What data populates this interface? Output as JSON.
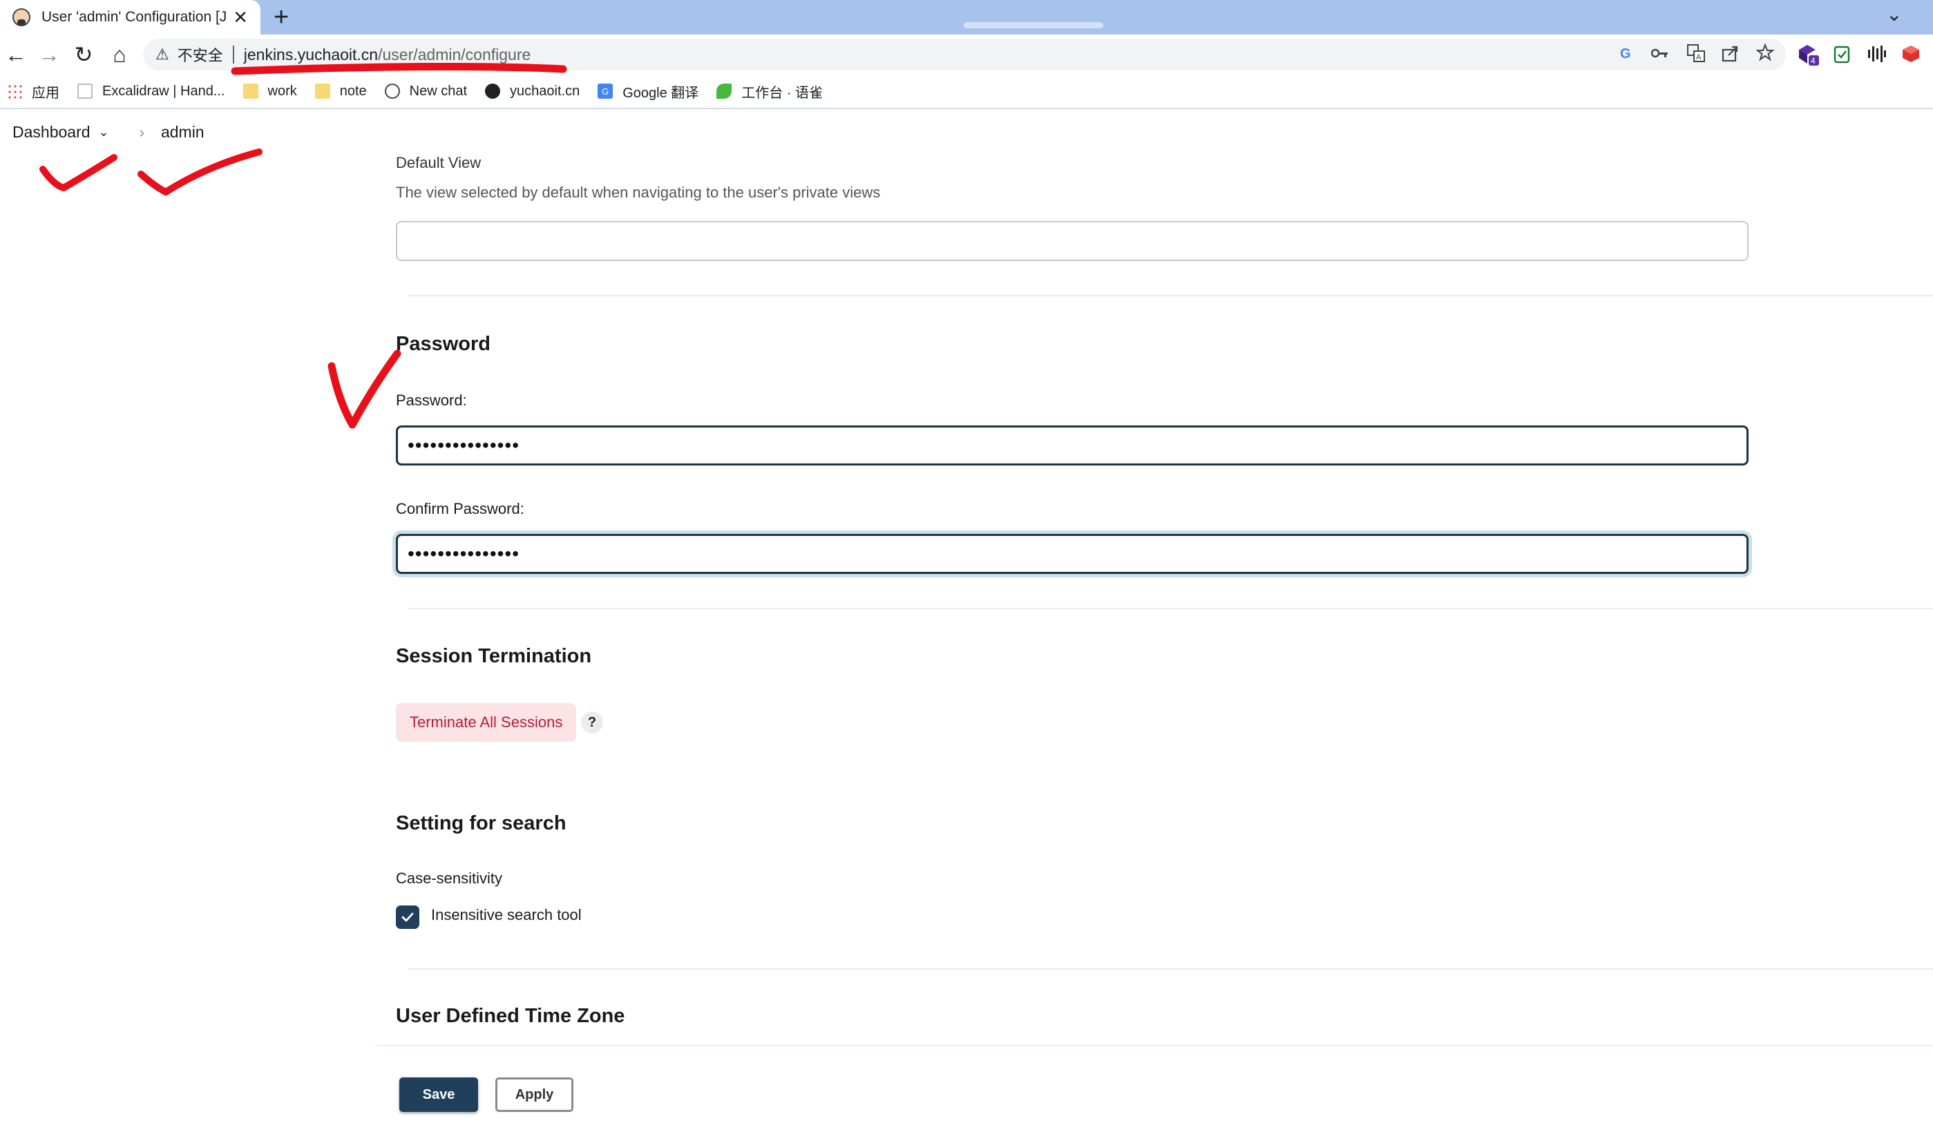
{
  "browser": {
    "tab": {
      "title": "User 'admin' Configuration [Je",
      "close": "✕"
    },
    "new_tab": "+",
    "tab_search": "⌄",
    "nav": {
      "back": "←",
      "forward": "→",
      "reload": "↻",
      "home": "⌂"
    },
    "omnibox": {
      "warning": "⚠",
      "insecure_label": "不安全",
      "url_host": "jenkins.yuchaoit.cn",
      "url_path": "/user/admin/configure"
    },
    "bookmarks": [
      {
        "label": "应用",
        "icon": "apps-grid-icon"
      },
      {
        "label": "Excalidraw | Hand...",
        "icon": "page-icon"
      },
      {
        "label": "work",
        "icon": "folder-icon"
      },
      {
        "label": "note",
        "icon": "folder-icon"
      },
      {
        "label": "New chat",
        "icon": "chat-icon"
      },
      {
        "label": "yuchaoit.cn",
        "icon": "globe-icon"
      },
      {
        "label": "Google 翻译",
        "icon": "google-translate-icon"
      },
      {
        "label": "工作台 · 语雀",
        "icon": "leaf-icon"
      }
    ],
    "extension_badge": "4"
  },
  "breadcrumb": {
    "dashboard": "Dashboard",
    "user": "admin"
  },
  "default_view": {
    "label": "Default View",
    "help": "The view selected by default when navigating to the user's private views",
    "value": ""
  },
  "password_section": {
    "title": "Password",
    "password_label": "Password:",
    "password_value": "•••••••••••••••",
    "confirm_label": "Confirm Password:",
    "confirm_value": "•••••••••••••••"
  },
  "session_section": {
    "title": "Session Termination",
    "terminate_label": "Terminate All Sessions",
    "help": "?"
  },
  "search_section": {
    "title": "Setting for search",
    "case_label": "Case-sensitivity",
    "insensitive_label": "Insensitive search tool",
    "insensitive_checked": true
  },
  "timezone_section": {
    "title": "User Defined Time Zone"
  },
  "actions": {
    "save": "Save",
    "apply": "Apply"
  },
  "colors": {
    "primary": "#1f3f5b",
    "danger_bg": "#fbe3e6",
    "danger_text": "#b51d3a",
    "annotation": "#e8101a"
  }
}
